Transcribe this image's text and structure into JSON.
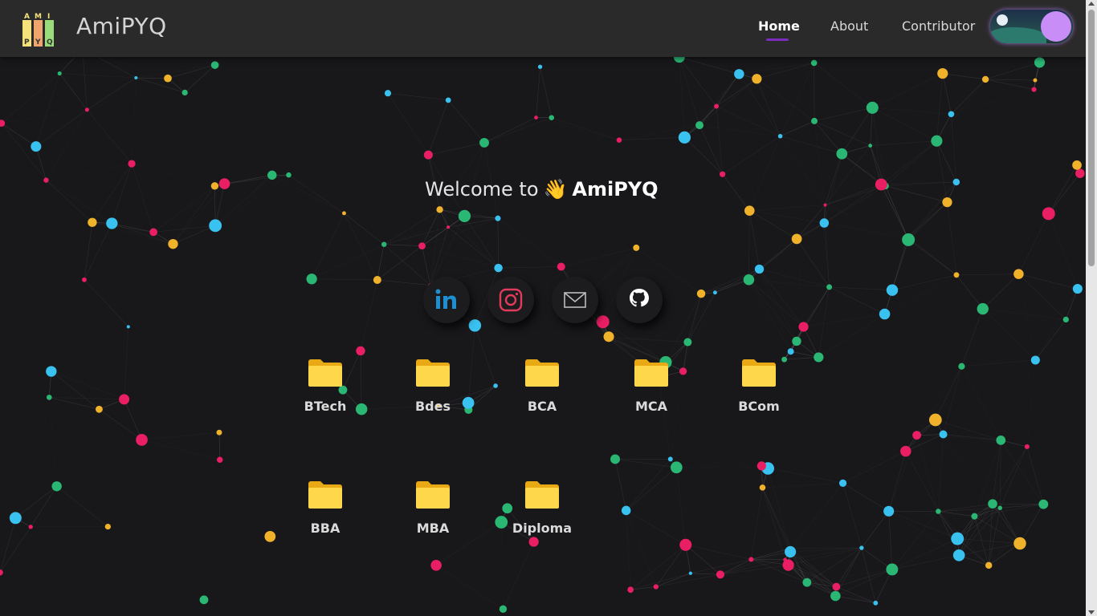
{
  "navbar": {
    "brand": "AmiPYQ",
    "logo_letters": [
      "A",
      "M",
      "I",
      "P",
      "Y",
      "Q"
    ],
    "links": [
      {
        "label": "Home",
        "active": true
      },
      {
        "label": "About",
        "active": false
      },
      {
        "label": "Contributor",
        "active": false
      }
    ],
    "theme_toggle": {
      "state": "dark-night",
      "knob_color": "#c88df7"
    }
  },
  "hero": {
    "welcome_prefix": "Welcome to",
    "welcome_emoji": "👋",
    "welcome_brand": "AmiPYQ"
  },
  "social_links": [
    {
      "name": "linkedin-icon",
      "color": "#1d8fd0"
    },
    {
      "name": "instagram-icon",
      "color": "#e23a5a"
    },
    {
      "name": "mail-icon",
      "color": "#bdbdbd"
    },
    {
      "name": "github-icon",
      "color": "#ffffff"
    }
  ],
  "courses": [
    {
      "label": "BTech"
    },
    {
      "label": "Bdes"
    },
    {
      "label": "BCA"
    },
    {
      "label": "MCA"
    },
    {
      "label": "BCom"
    },
    {
      "label": "BBA"
    },
    {
      "label": "MBA"
    },
    {
      "label": "Diploma"
    }
  ],
  "colors": {
    "background": "#18181b",
    "navbar": "#2a2a2a",
    "accent": "#7b2cbf",
    "folder": "#ffd74a",
    "particles": [
      "#e91e63",
      "#f0b22a",
      "#2ab673",
      "#39c1f0"
    ]
  }
}
